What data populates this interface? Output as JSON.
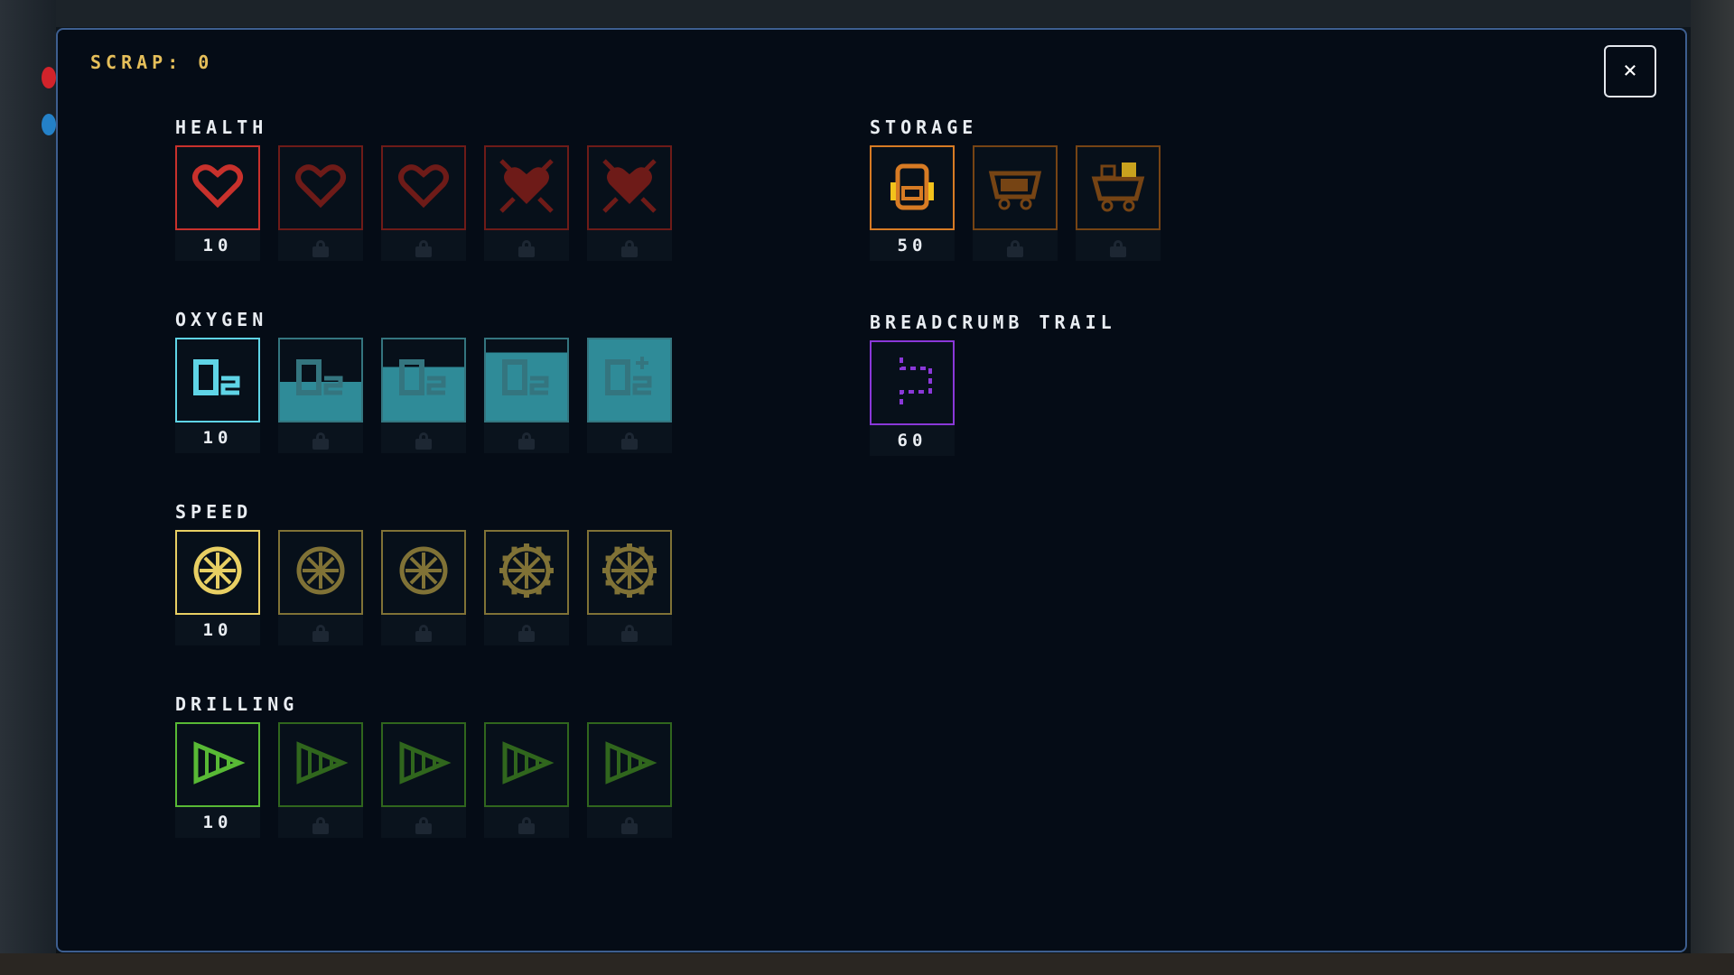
{
  "scrap_label": "SCRAP: 0",
  "close_label": "×",
  "colors": {
    "health": "#c8312c",
    "oxygen": "#5fd4e6",
    "speed": "#e8cf63",
    "drilling": "#58b935",
    "storage": "#d77b24",
    "breadcrumb": "#8a38d8"
  },
  "groups": [
    {
      "id": "health",
      "title": "HEALTH",
      "tiles": [
        {
          "icon": "heart-icon",
          "cost": "10",
          "locked": false
        },
        {
          "icon": "heart-icon",
          "cost": "",
          "locked": true
        },
        {
          "icon": "heart-icon",
          "cost": "",
          "locked": true
        },
        {
          "icon": "heart-burst-icon",
          "cost": "",
          "locked": true
        },
        {
          "icon": "heart-burst-icon",
          "cost": "",
          "locked": true
        }
      ]
    },
    {
      "id": "oxygen",
      "title": "OXYGEN",
      "tiles": [
        {
          "icon": "o2-icon",
          "cost": "10",
          "locked": false
        },
        {
          "icon": "o2-icon",
          "cost": "",
          "locked": true
        },
        {
          "icon": "o2-icon",
          "cost": "",
          "locked": true
        },
        {
          "icon": "o2-icon",
          "cost": "",
          "locked": true
        },
        {
          "icon": "o2-plus-icon",
          "cost": "",
          "locked": true
        }
      ]
    },
    {
      "id": "speed",
      "title": "SPEED",
      "tiles": [
        {
          "icon": "wheel-icon",
          "cost": "10",
          "locked": false
        },
        {
          "icon": "wheel-icon",
          "cost": "",
          "locked": true
        },
        {
          "icon": "wheel-icon",
          "cost": "",
          "locked": true
        },
        {
          "icon": "gear-wheel-icon",
          "cost": "",
          "locked": true
        },
        {
          "icon": "gear-wheel-icon",
          "cost": "",
          "locked": true
        }
      ]
    },
    {
      "id": "drilling",
      "title": "DRILLING",
      "tiles": [
        {
          "icon": "drill-icon",
          "cost": "10",
          "locked": false
        },
        {
          "icon": "drill-icon",
          "cost": "",
          "locked": true
        },
        {
          "icon": "drill-icon",
          "cost": "",
          "locked": true
        },
        {
          "icon": "drill-icon",
          "cost": "",
          "locked": true
        },
        {
          "icon": "drill-icon",
          "cost": "",
          "locked": true
        }
      ]
    },
    {
      "id": "storage",
      "title": "STORAGE",
      "tiles": [
        {
          "icon": "backpack-icon",
          "cost": "50",
          "locked": false
        },
        {
          "icon": "cart-icon",
          "cost": "",
          "locked": true
        },
        {
          "icon": "loaded-cart-icon",
          "cost": "",
          "locked": true
        }
      ]
    },
    {
      "id": "breadcrumb",
      "title": "BREADCRUMB TRAIL",
      "tiles": [
        {
          "icon": "trail-path-icon",
          "cost": "60",
          "locked": false
        }
      ]
    }
  ]
}
